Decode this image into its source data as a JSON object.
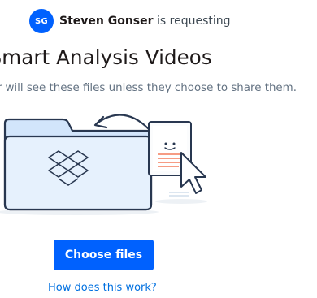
{
  "request": {
    "avatar_initials": "SG",
    "requester_name": "Steven Gonser",
    "requesting_text": " is requesting"
  },
  "header": {
    "title": "nSmart Analysis Videos",
    "subtitle": "nser will see these files unless they choose to share them."
  },
  "illustration": {
    "icons": [
      "folder-icon",
      "dropbox-logo-icon",
      "curved-arrow-icon",
      "document-icon",
      "cursor-icon"
    ]
  },
  "actions": {
    "choose_files_label": "Choose files",
    "how_link_label": "How does this work?"
  },
  "colors": {
    "accent": "#0061fe",
    "link": "#0070e0",
    "folder_fill": "#e6f1fd",
    "folder_stroke": "#283750",
    "doc_line": "#f47c5c"
  }
}
